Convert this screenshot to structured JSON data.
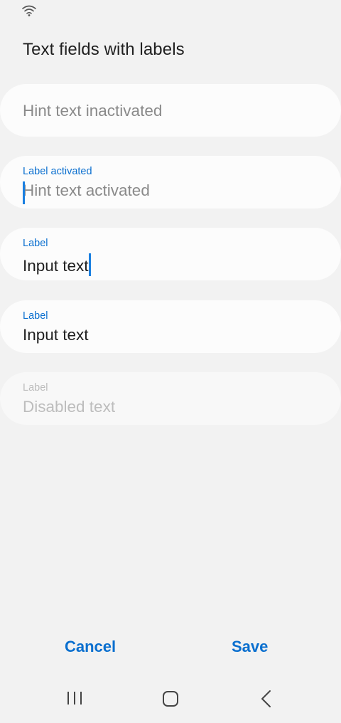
{
  "status_bar": {
    "wifi_icon": "wifi-icon"
  },
  "page": {
    "title": "Text fields with labels"
  },
  "fields": [
    {
      "hint": "Hint text inactivated",
      "state": "inactive"
    },
    {
      "label": "Label activated",
      "hint": "Hint text activated",
      "state": "activated"
    },
    {
      "label": "Label",
      "value": "Input text",
      "state": "editing"
    },
    {
      "label": "Label",
      "value": "Input text",
      "state": "filled"
    },
    {
      "label": "Label",
      "value": "Disabled text",
      "state": "disabled"
    }
  ],
  "actions": {
    "cancel_label": "Cancel",
    "save_label": "Save"
  },
  "navbar": {
    "recent_icon": "recent-apps-icon",
    "home_icon": "home-icon",
    "back_icon": "back-icon"
  },
  "colors": {
    "accent": "#0a6fcf",
    "caret": "#1a7fe0",
    "background": "#f2f2f2",
    "field": "#fcfcfc"
  }
}
